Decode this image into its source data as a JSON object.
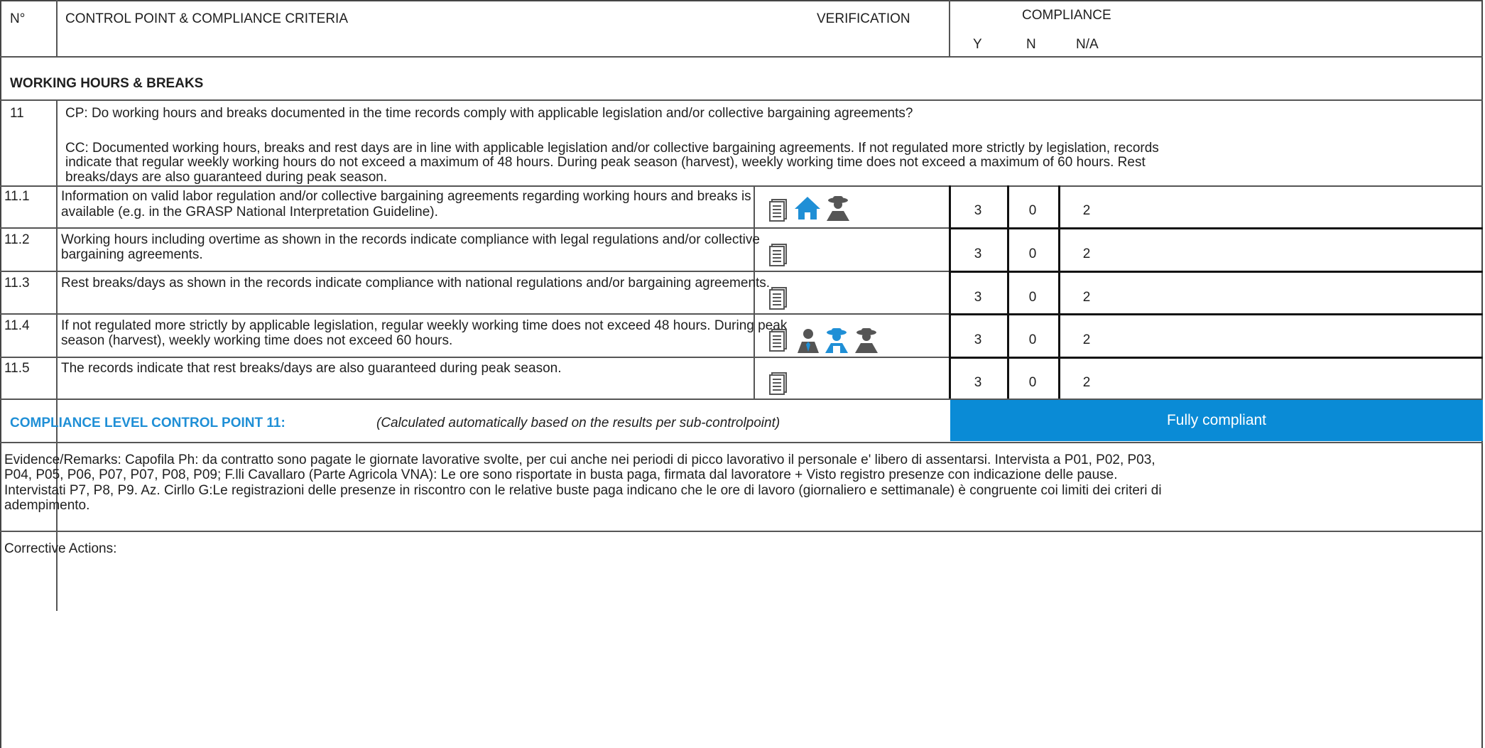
{
  "header": {
    "num_label": "N°",
    "cp_label": "CONTROL POINT & COMPLIANCE CRITERIA",
    "verification_label": "VERIFICATION",
    "compliance_label": "COMPLIANCE",
    "y_label": "Y",
    "n_label": "N",
    "na_label": "N/A"
  },
  "section": {
    "title": "WORKING HOURS & BREAKS"
  },
  "control_point": {
    "number": "11",
    "cp_text": "CP: Do working hours and breaks documented in the time records comply with applicable legislation and/or collective bargaining agreements?",
    "cc_line1": "CC: Documented working hours, breaks and rest days are in line with applicable legislation and/or collective bargaining agreements. If not regulated more strictly by legislation, records",
    "cc_line2": "indicate that regular weekly working hours do not exceed a maximum of 48 hours. During peak season (harvest), weekly working time does not exceed a maximum of 60 hours. Rest",
    "cc_line3": "breaks/days are also guaranteed during peak season."
  },
  "rows": [
    {
      "num": "11.1",
      "line1": "Information on valid labor regulation and/or collective bargaining agreements regarding working hours and breaks is",
      "line2": "available (e.g. in the GRASP National Interpretation Guideline).",
      "y": "3",
      "n": "0",
      "na": "2"
    },
    {
      "num": "11.2",
      "line1": "Working hours including overtime as shown in the records indicate compliance with legal regulations and/or collective",
      "line2": "bargaining agreements.",
      "y": "3",
      "n": "0",
      "na": "2"
    },
    {
      "num": "11.3",
      "line1": "Rest breaks/days as shown in the records indicate compliance with national regulations and/or bargaining agreements.",
      "line2": "",
      "y": "3",
      "n": "0",
      "na": "2"
    },
    {
      "num": "11.4",
      "line1": "If not regulated more strictly by applicable legislation, regular weekly working time does not exceed 48 hours. During peak",
      "line2": "season (harvest), weekly working time does not exceed 60 hours.",
      "y": "3",
      "n": "0",
      "na": "2"
    },
    {
      "num": "11.5",
      "line1": "The records indicate that rest breaks/days are also guaranteed during peak season.",
      "line2": "",
      "y": "3",
      "n": "0",
      "na": "2"
    }
  ],
  "compliance_level": {
    "label": "COMPLIANCE LEVEL CONTROL POINT 11:",
    "note": "(Calculated automatically based on the results per sub-controlpoint)",
    "status": "Fully compliant",
    "status_color": "#0a8bd6"
  },
  "evidence": {
    "line1": "Evidence/Remarks: Capofila Ph: da contratto sono pagate le giornate lavorative svolte, per cui anche nei periodi di picco lavorativo il personale e' libero di assentarsi. Intervista a P01, P02, P03,",
    "line2": "P04, P05, P06, P07, P07, P08, P09; F.lli Cavallaro (Parte Agricola VNA): Le ore sono risportate in busta paga, firmata dal lavoratore + Visto registro presenze con indicazione delle pause.",
    "line3": "Intervistati P7, P8, P9. Az. Cirllo G:Le registrazioni delle presenze in riscontro con le relative buste paga indicano che le ore di lavoro (giornaliero e settimanale) è congruente coi limiti dei criteri di",
    "line4": "adempimento."
  },
  "corrective": {
    "label": "Corrective Actions:"
  },
  "icons": {
    "document": "document-icon",
    "house": "house-icon",
    "worker": "worker-icon",
    "manager": "manager-icon",
    "worker_blue": "worker-blue-icon",
    "accent_color": "#1f8fd6",
    "icon_gray": "#555555"
  }
}
